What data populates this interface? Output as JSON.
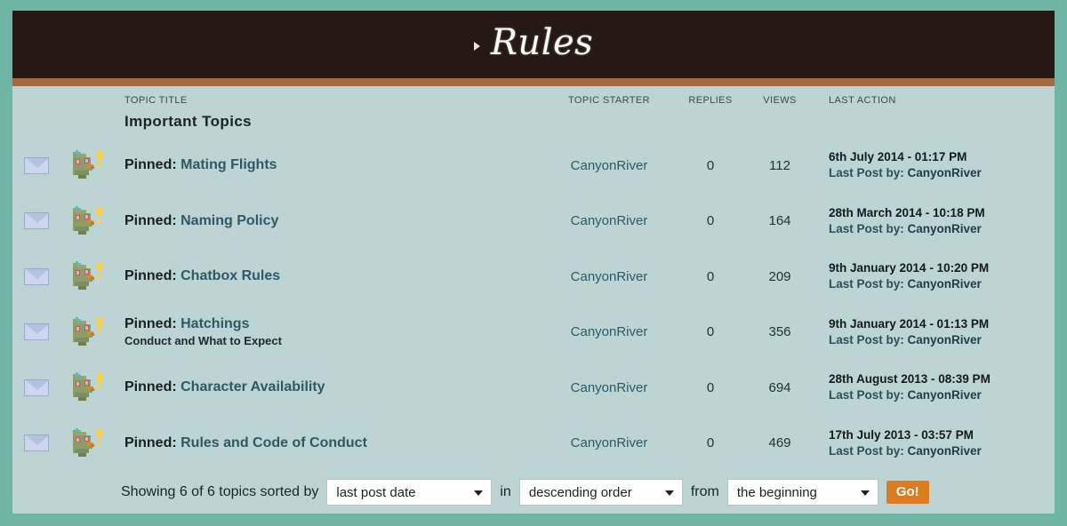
{
  "header": {
    "bullet_icon": "triangle-right-icon",
    "title": "Rules"
  },
  "columns": {
    "topic_title": "TOPIC TITLE",
    "topic_starter": "TOPIC STARTER",
    "replies": "REPLIES",
    "views": "VIEWS",
    "last_action": "LAST ACTION"
  },
  "section": {
    "heading": "Important Topics"
  },
  "row_icons": {
    "envelope": "envelope-icon",
    "pinned_topic": "pinned-dragon-icon"
  },
  "topics": [
    {
      "prefix": "Pinned:",
      "name": "Mating Flights",
      "subtitle": "",
      "starter": "CanyonRiver",
      "replies": "0",
      "views": "112",
      "last_date": "6th July 2014 - 01:17 PM",
      "last_post_label": "Last Post by:",
      "last_post_user": "CanyonRiver"
    },
    {
      "prefix": "Pinned:",
      "name": "Naming Policy",
      "subtitle": "",
      "starter": "CanyonRiver",
      "replies": "0",
      "views": "164",
      "last_date": "28th March 2014 - 10:18 PM",
      "last_post_label": "Last Post by:",
      "last_post_user": "CanyonRiver"
    },
    {
      "prefix": "Pinned:",
      "name": "Chatbox Rules",
      "subtitle": "",
      "starter": "CanyonRiver",
      "replies": "0",
      "views": "209",
      "last_date": "9th January 2014 - 10:20 PM",
      "last_post_label": "Last Post by:",
      "last_post_user": "CanyonRiver"
    },
    {
      "prefix": "Pinned:",
      "name": "Hatchings",
      "subtitle": "Conduct and What to Expect",
      "starter": "CanyonRiver",
      "replies": "0",
      "views": "356",
      "last_date": "9th January 2014 - 01:13 PM",
      "last_post_label": "Last Post by:",
      "last_post_user": "CanyonRiver"
    },
    {
      "prefix": "Pinned:",
      "name": "Character Availability",
      "subtitle": "",
      "starter": "CanyonRiver",
      "replies": "0",
      "views": "694",
      "last_date": "28th August 2013 - 08:39 PM",
      "last_post_label": "Last Post by:",
      "last_post_user": "CanyonRiver"
    },
    {
      "prefix": "Pinned:",
      "name": "Rules and Code of Conduct",
      "subtitle": "",
      "starter": "CanyonRiver",
      "replies": "0",
      "views": "469",
      "last_date": "17th July 2013 - 03:57 PM",
      "last_post_label": "Last Post by:",
      "last_post_user": "CanyonRiver"
    }
  ],
  "footer": {
    "showing_text": "Showing 6 of 6 topics sorted by",
    "sort_value": "last post date",
    "in_text": "in",
    "order_value": "descending order",
    "from_text": "from",
    "from_value": "the beginning",
    "go_label": "Go!",
    "caret_icon": "chevron-down-icon"
  },
  "colors": {
    "frame": "#6fb5a6",
    "titlebar": "#241a13",
    "accent_stripe": "#a56a40",
    "panel": "#bdd4d4",
    "link": "#2e5866",
    "go_button": "#dd7c1e"
  }
}
